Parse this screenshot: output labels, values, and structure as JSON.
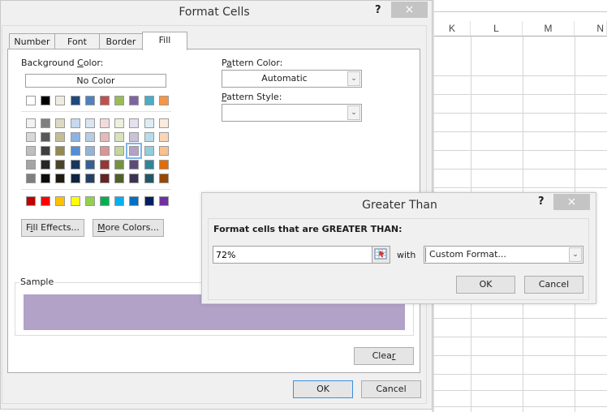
{
  "spreadsheet": {
    "columns": [
      "K",
      "L",
      "M",
      "N"
    ]
  },
  "format_cells": {
    "title": "Format Cells",
    "help_label": "?",
    "close_label": "×",
    "tabs": [
      {
        "label": "Number",
        "active": false
      },
      {
        "label": "Font",
        "active": false
      },
      {
        "label": "Border",
        "active": false
      },
      {
        "label": "Fill",
        "active": true
      }
    ],
    "background_color_label": "Background Color:",
    "background_color_label_pre": "Background ",
    "background_color_label_u": "C",
    "background_color_label_post": "olor:",
    "no_color_label": "No Color",
    "palette": {
      "theme_top_row": [
        "#ffffff",
        "#000000",
        "#eeece1",
        "#1f497d",
        "#4f81bd",
        "#c0504d",
        "#9bbb59",
        "#8064a2",
        "#4bacc6",
        "#f79646"
      ],
      "theme_shades": [
        [
          "#f2f2f2",
          "#7f7f7f",
          "#ddd9c3",
          "#c6d9f0",
          "#dbe5f1",
          "#f2dcdb",
          "#ebf1dd",
          "#e5e0ec",
          "#dbeef3",
          "#fdeada"
        ],
        [
          "#d8d8d8",
          "#595959",
          "#c4bd97",
          "#8db3e2",
          "#b8cce4",
          "#e5b9b7",
          "#d7e3bc",
          "#ccc1d9",
          "#b7dde8",
          "#fbd5b5"
        ],
        [
          "#bfbfbf",
          "#3f3f3f",
          "#938953",
          "#548dd4",
          "#95b3d7",
          "#d99694",
          "#c3d69b",
          "#b2a2c7",
          "#92cddc",
          "#fac08f"
        ],
        [
          "#a5a5a5",
          "#262626",
          "#494429",
          "#17365d",
          "#366092",
          "#953734",
          "#76923c",
          "#5f497a",
          "#31859b",
          "#e36c09"
        ],
        [
          "#7f7f7f",
          "#0c0c0c",
          "#1d1b10",
          "#0f243e",
          "#244061",
          "#632423",
          "#4f6128",
          "#3f3151",
          "#205867",
          "#974806"
        ]
      ],
      "standard": [
        "#c00000",
        "#ff0000",
        "#ffc000",
        "#ffff00",
        "#92d050",
        "#00b050",
        "#00b0f0",
        "#0070c0",
        "#002060",
        "#7030a0"
      ],
      "selected": "#b2a2c7"
    },
    "pattern_color_label_pre": "P",
    "pattern_color_label_u": "a",
    "pattern_color_label_post": "ttern Color:",
    "pattern_color_value": "Automatic",
    "pattern_style_label_u": "P",
    "pattern_style_label_post": "attern Style:",
    "pattern_style_value": "",
    "fill_effects_pre": "F",
    "fill_effects_u": "i",
    "fill_effects_post": "ll Effects...",
    "more_colors_u": "M",
    "more_colors_post": "ore Colors...",
    "sample_label": "Sample",
    "sample_color": "#b2a2c7",
    "clear_pre": "Clea",
    "clear_u": "r",
    "ok_label": "OK",
    "cancel_label": "Cancel"
  },
  "greater_than": {
    "title": "Greater Than",
    "help_label": "?",
    "close_label": "×",
    "prompt": "Format cells that are GREATER THAN:",
    "value": "72%",
    "with_label": "with",
    "format_value": "Custom Format...",
    "ok_label": "OK",
    "cancel_label": "Cancel"
  }
}
